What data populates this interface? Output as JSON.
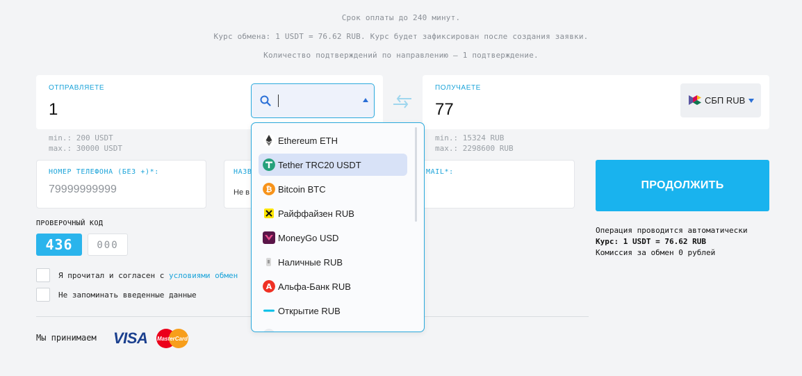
{
  "info": {
    "line1": "Срок оплаты до 240 минут.",
    "line2": "Курс обмена: 1 USDT = 76.62 RUB. Курс будет зафиксирован после создания заявки.",
    "line3": "Количество подтверждений по направлению — 1 подтверждение."
  },
  "send": {
    "label": "ОТПРАВЛЯЕТЕ",
    "amount": "1",
    "min": "min.: 200 USDT",
    "max": "max.: 30000 USDT",
    "search_value": ""
  },
  "receive": {
    "label": "ПОЛУЧАЕТЕ",
    "amount": "77",
    "currency": "СБП RUB",
    "min": "min.: 15324 RUB",
    "max": "max.: 2298600 RUB"
  },
  "fields": {
    "phone_label": "НОМЕР ТЕЛЕФОНА (БЕЗ +)*:",
    "phone_placeholder": "79999999999",
    "name_label_partial": "НАЗВ",
    "name_value_partial": "Не в",
    "email_label_partial": "MAIL*:"
  },
  "verification": {
    "label": "ПРОВЕРОЧНЫЙ КОД",
    "captcha": "436",
    "input_placeholder": "000"
  },
  "checkboxes": {
    "agree_text": "Я прочитал и согласен с ",
    "agree_link": "условиями обмен",
    "remember_text": "Не запоминать введенные данные"
  },
  "continue_button": "ПРОДОЛЖИТЬ",
  "operation": {
    "auto": "Операция проводится автоматически",
    "rate": "Курс: 1 USDT = 76.62 RUB",
    "fee": "Комиссия за обмен 0 рублей"
  },
  "footer": {
    "accept": "Мы принимаем",
    "visa": "VISA",
    "mastercard": "MasterCard"
  },
  "dropdown": {
    "items": [
      {
        "label": "Ethereum ETH",
        "icon": "ethereum-icon",
        "color": "#ffffff"
      },
      {
        "label": "Tether TRC20 USDT",
        "icon": "tether-icon",
        "color": "#26a17b"
      },
      {
        "label": "Bitcoin BTC",
        "icon": "bitcoin-icon",
        "color": "#f7931a"
      },
      {
        "label": "Райффайзен RUB",
        "icon": "raiffeisen-icon",
        "color": "#fee600"
      },
      {
        "label": "MoneyGo USD",
        "icon": "moneygo-icon",
        "color": "#9b1e5a"
      },
      {
        "label": "Наличные RUB",
        "icon": "cash-icon",
        "color": "#ffffff"
      },
      {
        "label": "Альфа-Банк RUB",
        "icon": "alfabank-icon",
        "color": "#ef3124"
      },
      {
        "label": "Открытие RUB",
        "icon": "otkritie-icon",
        "color": "#00bfe8"
      }
    ],
    "active_index": 1
  },
  "colors": {
    "accent": "#1aa3d9",
    "button": "#19b3ee",
    "captcha_bg": "#2ab4ec"
  }
}
